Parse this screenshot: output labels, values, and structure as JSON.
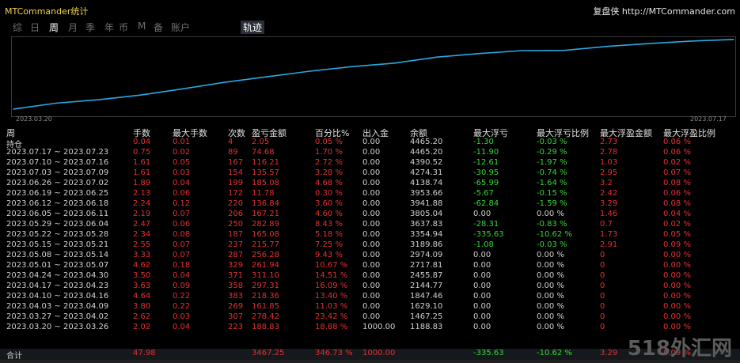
{
  "window": {
    "title": "MTCommander统计",
    "site_label": "复盘侠 http://MTCommander.com"
  },
  "tabs": [
    {
      "label": "综",
      "active": false
    },
    {
      "label": "日",
      "active": false
    },
    {
      "label": "周",
      "active": true
    },
    {
      "label": "月",
      "active": false
    },
    {
      "label": "季",
      "active": false
    },
    {
      "label": "年",
      "active": false
    },
    {
      "label": "币",
      "active": false
    },
    {
      "label": "M",
      "active": false
    },
    {
      "label": "备",
      "active": false
    },
    {
      "label": "账户",
      "active": false
    },
    {
      "label": "轨迹",
      "active": true
    }
  ],
  "chart": {
    "x_start_label": "2023.03.20",
    "x_end_label": "2023.07.17",
    "line_color": "#2aa8e0"
  },
  "chart_data": {
    "type": "line",
    "x": [
      "2023.03.20",
      "2023.03.27",
      "2023.04.03",
      "2023.04.10",
      "2023.04.17",
      "2023.04.24",
      "2023.05.01",
      "2023.05.08",
      "2023.05.15",
      "2023.05.22",
      "2023.05.29",
      "2023.06.05",
      "2023.06.12",
      "2023.06.19",
      "2023.06.26",
      "2023.07.03",
      "2023.07.10",
      "2023.07.17"
    ],
    "series": [
      {
        "values": [
          1188.83,
          1467.25,
          1629.1,
          1847.46,
          2144.77,
          2455.87,
          2717.81,
          2974.09,
          3189.86,
          3354.94,
          3637.83,
          3805.04,
          3941.88,
          3953.66,
          4138.74,
          4274.31,
          4390.52,
          4465.2
        ]
      }
    ],
    "title": "",
    "xlabel": "",
    "ylabel": "",
    "ylim": [
      1000,
      4500
    ],
    "grid": false
  },
  "table": {
    "headers": [
      "周",
      "手数",
      "最大手数",
      "次数",
      "盈亏金额",
      "百分比%",
      "出入金",
      "余额",
      "最大浮亏",
      "最大浮亏比例",
      "最大浮盈金额",
      "最大浮盈比例"
    ],
    "rows": [
      {
        "period": "持仓",
        "lots": "0.04",
        "max_lots": "0.01",
        "count": "4",
        "pnl": "2.05",
        "pct": "0.05 %",
        "deposit": "0.00",
        "balance": "4465.20",
        "max_float_loss": "-1.30",
        "max_float_loss_pct": "-0.03 %",
        "max_float_profit": "2.73",
        "max_float_profit_pct": "0.06 %"
      },
      {
        "period": "2023.07.17 ~ 2023.07.23",
        "lots": "0.75",
        "max_lots": "0.02",
        "count": "89",
        "pnl": "74.68",
        "pct": "1.70 %",
        "deposit": "0.00",
        "balance": "4465.20",
        "max_float_loss": "-11.90",
        "max_float_loss_pct": "-0.29 %",
        "max_float_profit": "2.78",
        "max_float_profit_pct": "0.06 %"
      },
      {
        "period": "2023.07.10 ~ 2023.07.16",
        "lots": "1.61",
        "max_lots": "0.05",
        "count": "167",
        "pnl": "116.21",
        "pct": "2.72 %",
        "deposit": "0.00",
        "balance": "4390.52",
        "max_float_loss": "-12.61",
        "max_float_loss_pct": "-1.97 %",
        "max_float_profit": "1.03",
        "max_float_profit_pct": "0.02 %"
      },
      {
        "period": "2023.07.03 ~ 2023.07.09",
        "lots": "1.61",
        "max_lots": "0.03",
        "count": "154",
        "pnl": "135.57",
        "pct": "3.28 %",
        "deposit": "0.00",
        "balance": "4274.31",
        "max_float_loss": "-30.95",
        "max_float_loss_pct": "-0.74 %",
        "max_float_profit": "2.95",
        "max_float_profit_pct": "0.07 %"
      },
      {
        "period": "2023.06.26 ~ 2023.07.02",
        "lots": "1.89",
        "max_lots": "0.04",
        "count": "199",
        "pnl": "185.08",
        "pct": "4.68 %",
        "deposit": "0.00",
        "balance": "4138.74",
        "max_float_loss": "-65.99",
        "max_float_loss_pct": "-1.64 %",
        "max_float_profit": "3.2",
        "max_float_profit_pct": "0.08 %"
      },
      {
        "period": "2023.06.19 ~ 2023.06.25",
        "lots": "2.13",
        "max_lots": "0.06",
        "count": "172",
        "pnl": "11.78",
        "pct": "0.30 %",
        "deposit": "0.00",
        "balance": "3953.66",
        "max_float_loss": "-5.67",
        "max_float_loss_pct": "-0.15 %",
        "max_float_profit": "2.42",
        "max_float_profit_pct": "0.06 %"
      },
      {
        "period": "2023.06.12 ~ 2023.06.18",
        "lots": "2.24",
        "max_lots": "0.12",
        "count": "220",
        "pnl": "136.84",
        "pct": "3.60 %",
        "deposit": "0.00",
        "balance": "3941.88",
        "max_float_loss": "-62.84",
        "max_float_loss_pct": "-1.59 %",
        "max_float_profit": "3.29",
        "max_float_profit_pct": "0.08 %"
      },
      {
        "period": "2023.06.05 ~ 2023.06.11",
        "lots": "2.19",
        "max_lots": "0.07",
        "count": "206",
        "pnl": "167.21",
        "pct": "4.60 %",
        "deposit": "0.00",
        "balance": "3805.04",
        "max_float_loss": "0.00",
        "max_float_loss_pct": "0.00 %",
        "max_float_profit": "1.46",
        "max_float_profit_pct": "0.04 %"
      },
      {
        "period": "2023.05.29 ~ 2023.06.04",
        "lots": "2.47",
        "max_lots": "0.06",
        "count": "250",
        "pnl": "282.89",
        "pct": "8.43 %",
        "deposit": "0.00",
        "balance": "3637.83",
        "max_float_loss": "-28.31",
        "max_float_loss_pct": "-0.83 %",
        "max_float_profit": "0.7",
        "max_float_profit_pct": "0.02 %"
      },
      {
        "period": "2023.05.22 ~ 2023.05.28",
        "lots": "2.34",
        "max_lots": "0.08",
        "count": "187",
        "pnl": "165.08",
        "pct": "5.18 %",
        "deposit": "0.00",
        "balance": "3354.94",
        "max_float_loss": "-335.63",
        "max_float_loss_pct": "-10.62 %",
        "max_float_profit": "1.73",
        "max_float_profit_pct": "0.05 %"
      },
      {
        "period": "2023.05.15 ~ 2023.05.21",
        "lots": "2.55",
        "max_lots": "0.07",
        "count": "237",
        "pnl": "215.77",
        "pct": "7.25 %",
        "deposit": "0.00",
        "balance": "3189.86",
        "max_float_loss": "-1.08",
        "max_float_loss_pct": "-0.03 %",
        "max_float_profit": "2.91",
        "max_float_profit_pct": "0.09 %"
      },
      {
        "period": "2023.05.08 ~ 2023.05.14",
        "lots": "3.33",
        "max_lots": "0.07",
        "count": "287",
        "pnl": "256.28",
        "pct": "9.43 %",
        "deposit": "0.00",
        "balance": "2974.09",
        "max_float_loss": "0.00",
        "max_float_loss_pct": "0.00 %",
        "max_float_profit": "0",
        "max_float_profit_pct": "0.00 %"
      },
      {
        "period": "2023.05.01 ~ 2023.05.07",
        "lots": "4.62",
        "max_lots": "0.18",
        "count": "329",
        "pnl": "261.94",
        "pct": "10.67 %",
        "deposit": "0.00",
        "balance": "2717.81",
        "max_float_loss": "0.00",
        "max_float_loss_pct": "0.00 %",
        "max_float_profit": "0",
        "max_float_profit_pct": "0.00 %"
      },
      {
        "period": "2023.04.24 ~ 2023.04.30",
        "lots": "3.50",
        "max_lots": "0.04",
        "count": "371",
        "pnl": "311.10",
        "pct": "14.51 %",
        "deposit": "0.00",
        "balance": "2455.87",
        "max_float_loss": "0.00",
        "max_float_loss_pct": "0.00 %",
        "max_float_profit": "0",
        "max_float_profit_pct": "0.00 %"
      },
      {
        "period": "2023.04.17 ~ 2023.04.23",
        "lots": "3.63",
        "max_lots": "0.09",
        "count": "358",
        "pnl": "297.31",
        "pct": "16.09 %",
        "deposit": "0.00",
        "balance": "2144.77",
        "max_float_loss": "0.00",
        "max_float_loss_pct": "0.00 %",
        "max_float_profit": "0",
        "max_float_profit_pct": "0.00 %"
      },
      {
        "period": "2023.04.10 ~ 2023.04.16",
        "lots": "4.64",
        "max_lots": "0.22",
        "count": "383",
        "pnl": "218.36",
        "pct": "13.40 %",
        "deposit": "0.00",
        "balance": "1847.46",
        "max_float_loss": "0.00",
        "max_float_loss_pct": "0.00 %",
        "max_float_profit": "0",
        "max_float_profit_pct": "0.00 %"
      },
      {
        "period": "2023.04.03 ~ 2023.04.09",
        "lots": "3.80",
        "max_lots": "0.22",
        "count": "269",
        "pnl": "161.85",
        "pct": "11.03 %",
        "deposit": "0.00",
        "balance": "1629.10",
        "max_float_loss": "0.00",
        "max_float_loss_pct": "0.00 %",
        "max_float_profit": "0",
        "max_float_profit_pct": "0.00 %"
      },
      {
        "period": "2023.03.27 ~ 2023.04.02",
        "lots": "2.62",
        "max_lots": "0.03",
        "count": "307",
        "pnl": "278.42",
        "pct": "23.42 %",
        "deposit": "0.00",
        "balance": "1467.25",
        "max_float_loss": "0.00",
        "max_float_loss_pct": "0.00 %",
        "max_float_profit": "0",
        "max_float_profit_pct": "0.00 %"
      },
      {
        "period": "2023.03.20 ~ 2023.03.26",
        "lots": "2.02",
        "max_lots": "0.04",
        "count": "223",
        "pnl": "188.83",
        "pct": "18.88 %",
        "deposit": "1000.00",
        "balance": "1188.83",
        "max_float_loss": "0.00",
        "max_float_loss_pct": "0.00 %",
        "max_float_profit": "0",
        "max_float_profit_pct": "0.00 %"
      }
    ],
    "total": {
      "period": "合计",
      "lots": "47.98",
      "max_lots": "",
      "count": "",
      "pnl": "3467.25",
      "pct": "346.73 %",
      "deposit": "1000.00",
      "balance": "",
      "max_float_loss": "-335.63",
      "max_float_loss_pct": "-10.62 %",
      "max_float_profit": "3.29",
      "max_float_profit_pct": "0.09 %"
    }
  },
  "watermark": "518外汇网",
  "colors": {
    "positive": "#e23030",
    "negative": "#35d635",
    "neutral": "#d0d0d0",
    "title": "#f2d34a"
  }
}
